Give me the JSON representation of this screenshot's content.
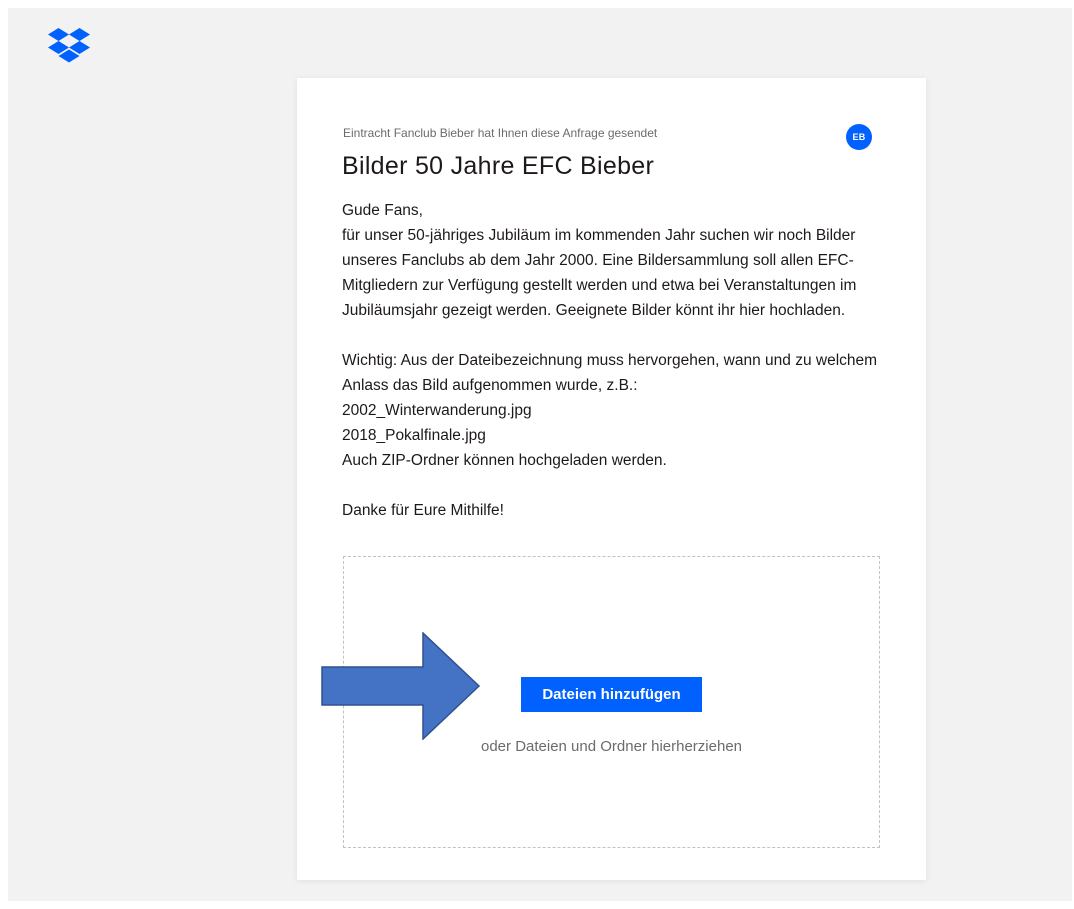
{
  "brand": {
    "logo_icon": "dropbox-logo-icon",
    "color": "#0061fe"
  },
  "request": {
    "sender_text": "Eintracht Fanclub Bieber hat Ihnen diese Anfrage gesendet",
    "avatar_initials": "EB",
    "title": "Bilder 50 Jahre EFC Bieber",
    "description": "Gude Fans,\nfür unser 50-jähriges Jubiläum im kommenden Jahr suchen wir noch Bilder unseres Fanclubs ab dem Jahr 2000. Eine Bildersammlung soll allen EFC-Mitgliedern zur Verfügung gestellt werden und etwa bei Veranstaltungen im Jubiläumsjahr gezeigt werden. Geeignete Bilder könnt ihr hier hochladen.\n\nWichtig: Aus der Dateibezeichnung muss hervorgehen, wann und zu welchem Anlass das Bild aufgenommen wurde, z.B.:\n2002_Winterwanderung.jpg\n2018_Pokalfinale.jpg\nAuch ZIP-Ordner können hochgeladen werden.\n\nDanke für Eure Mithilfe!"
  },
  "upload": {
    "button_label": "Dateien hinzufügen",
    "drop_hint": "oder Dateien und Ordner hierherziehen"
  },
  "annotation": {
    "arrow_icon": "right-arrow-icon",
    "fill_color": "#4472c4",
    "stroke_color": "#2f528f"
  }
}
